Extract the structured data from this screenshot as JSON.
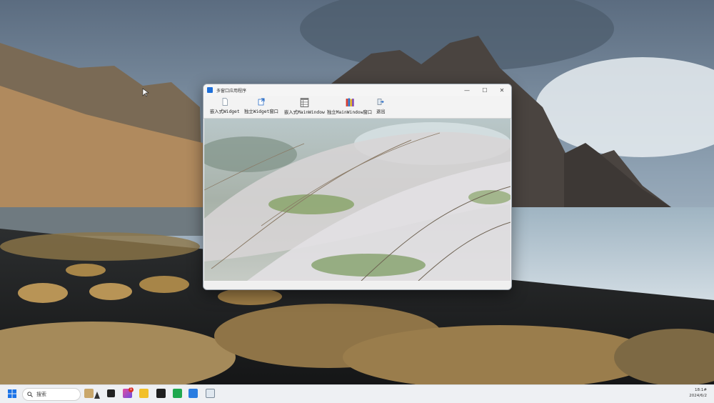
{
  "window": {
    "title": "多窗口应用程序",
    "controls": {
      "minimize": "—",
      "maximize": "☐",
      "close": "✕"
    }
  },
  "toolbar": {
    "items": [
      {
        "label": "嵌入式Widget",
        "icon": "file-icon"
      },
      {
        "label": "独立Widget窗口",
        "icon": "open-window-icon"
      },
      {
        "label": "嵌入式MainWindow",
        "icon": "grid-icon"
      },
      {
        "label": "独立MainWindow窗口",
        "icon": "books-icon"
      },
      {
        "label": "退出",
        "icon": "exit-icon"
      }
    ]
  },
  "taskbar": {
    "search_label": "搜索",
    "notification_badge": "1",
    "clock_time": "18:1#",
    "clock_date": "2024/6/2"
  },
  "colors": {
    "accent": "#1e6fd9",
    "taskbar": "#eef0f3",
    "window": "#f3f3f3"
  }
}
